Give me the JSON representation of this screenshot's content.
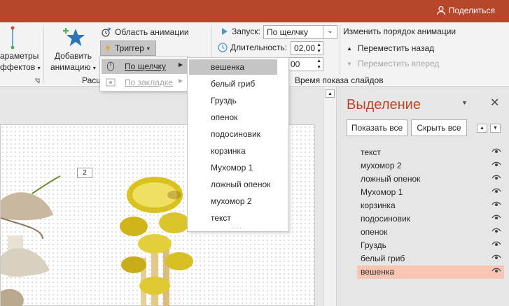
{
  "title_bar": {
    "share_label": "Поделиться"
  },
  "ribbon": {
    "effect_params_line1": "араметры",
    "effect_params_line2": "ффектов",
    "add_animation_line1": "Добавить",
    "add_animation_line2": "анимацию",
    "animation_pane": "Область анимации",
    "trigger": "Триггер",
    "group_advanced": "Расш",
    "start_label": "Запуск:",
    "start_value": "По щелчку",
    "duration_label": "Длительность:",
    "duration_value": "02,00",
    "delay_value": "00",
    "group_timing": "Время показа слайдов",
    "reorder_title": "Изменить порядок анимации",
    "move_back": "Переместить назад",
    "move_forward": "Переместить вперед"
  },
  "trigger_menu": {
    "on_click": "По щелчку",
    "on_bookmark": "По закладке"
  },
  "shape_list": [
    "вешенка",
    "белый гриб",
    "Груздь",
    "опенок",
    "подосиновик",
    "корзинка",
    "Мухомор 1",
    "ложный опенок",
    "мухомор 2",
    "текст"
  ],
  "slide": {
    "number_tag": "2"
  },
  "selection_pane": {
    "title": "Выделение",
    "show_all": "Показать все",
    "hide_all": "Скрыть все",
    "items": [
      "текст",
      "мухомор 2",
      "ложный опенок",
      "Мухомор 1",
      "корзинка",
      "подосиновик",
      "опенок",
      "Груздь",
      "белый гриб",
      "вешенка"
    ],
    "selected": "вешенка"
  },
  "colors": {
    "accent": "#b7472a",
    "highlight": "#f9c6b4",
    "menu_highlight": "#c5c5c5"
  }
}
